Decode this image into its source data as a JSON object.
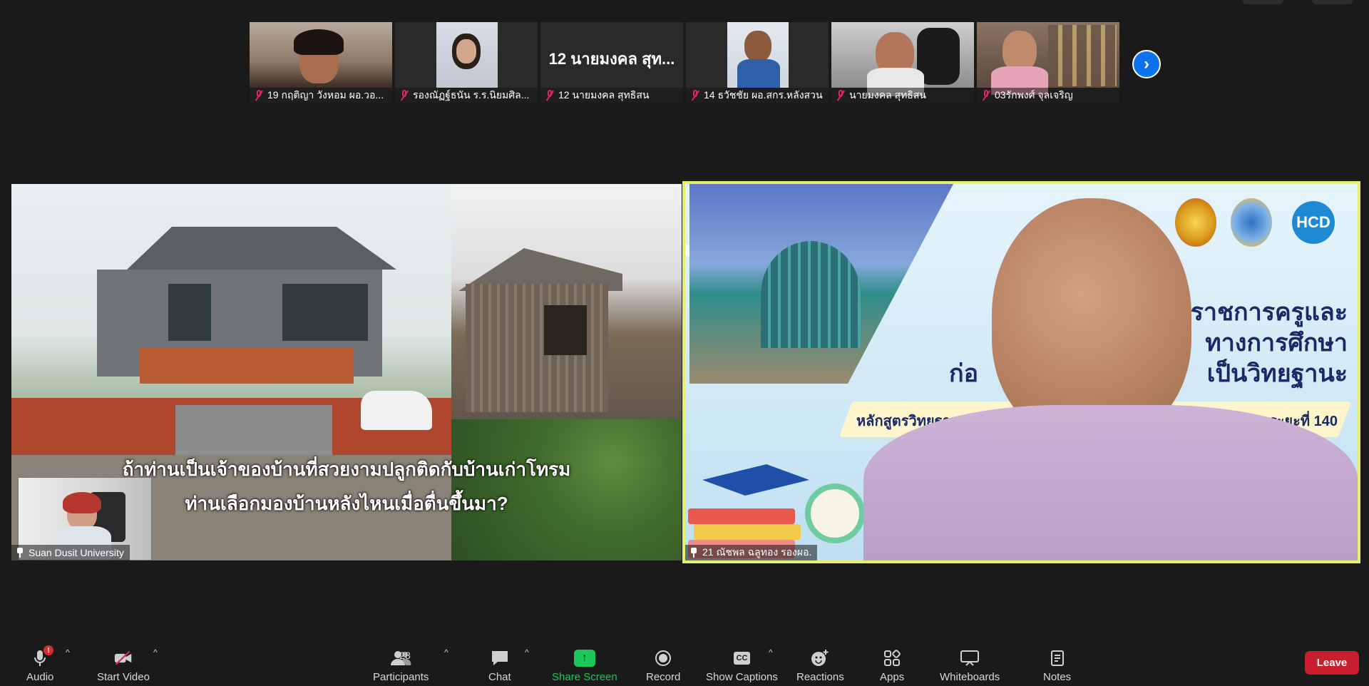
{
  "participants_strip": [
    {
      "name": "19 กฤติญา วังหอม ผอ.วอ...",
      "muted": true,
      "video": true
    },
    {
      "name": "รองณัฏฐ์ธนัน  ร.ร.นิยมศิล...",
      "muted": true,
      "video": true
    },
    {
      "name": "12 นายมงคล สุทธิสน",
      "muted": true,
      "video": false,
      "display_name": "12 นายมงคล สุท..."
    },
    {
      "name": "14 ธวัชชัย ผอ.สกร.หลังสวน",
      "muted": true,
      "video": true
    },
    {
      "name": "นายมงคล สุทธิสน",
      "muted": true,
      "video": true
    },
    {
      "name": "03รักพงศ์ จุลเจริญ",
      "muted": true,
      "video": true
    }
  ],
  "next_page_icon": "chevron-right",
  "main_tiles": {
    "left": {
      "nameplate": "Suan Dusit University",
      "caption_line1": "ถ้าท่านเป็นเจ้าของบ้านที่สวยงามปลูกติดกับบ้านเก่าโทรม",
      "caption_line2": "ท่านเลือกมองบ้านหลังไหนเมื่อตื่นขึ้นมา?"
    },
    "right": {
      "nameplate": "21 ณัชพล ฉลูทอง รองผอ.",
      "title_line1": "ราชการครูและ",
      "title_line2": "ทางการศึกษา",
      "title_line3_left": "ก่อ",
      "title_line3_right": "เป็นวิทยฐานะ",
      "banner_left": "หลักสูตรวิทยฐานะผู้อำน",
      "banner_right": "ารเชี่ยวชาญ ระยะที่ 140",
      "logo_text": "HCD",
      "active_speaker_color": "#e6ef6e"
    }
  },
  "toolbar": {
    "audio": {
      "label": "Audio",
      "badge": "!"
    },
    "video": {
      "label": "Start Video"
    },
    "participants": {
      "label": "Participants",
      "count": "28"
    },
    "chat": {
      "label": "Chat"
    },
    "share": {
      "label": "Share Screen",
      "color": "#1ec75b"
    },
    "record": {
      "label": "Record"
    },
    "captions": {
      "label": "Show Captions",
      "icon_text": "CC"
    },
    "reactions": {
      "label": "Reactions"
    },
    "apps": {
      "label": "Apps"
    },
    "whiteboards": {
      "label": "Whiteboards"
    },
    "notes": {
      "label": "Notes"
    },
    "leave": {
      "label": "Leave",
      "color": "#c81e2e"
    }
  }
}
